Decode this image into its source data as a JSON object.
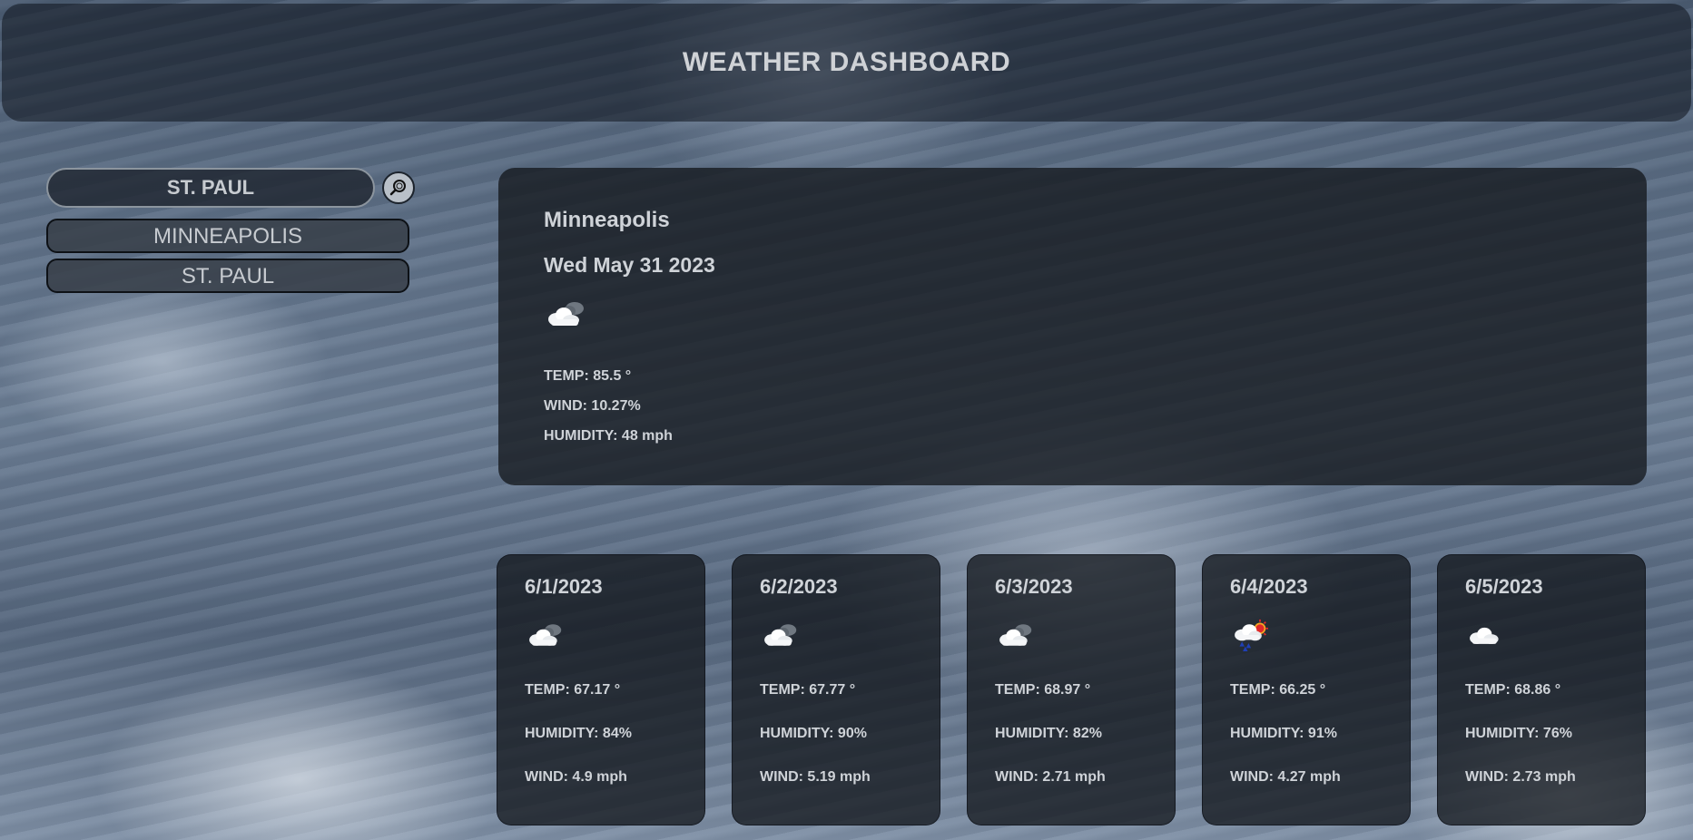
{
  "header": {
    "title": "WEATHER DASHBOARD"
  },
  "search": {
    "value": "ST. PAUL",
    "history": [
      "MINNEAPOLIS",
      "ST. PAUL"
    ]
  },
  "current": {
    "city": "Minneapolis",
    "date": "Wed May 31 2023",
    "icon": "broken-clouds-icon",
    "temp": "TEMP: 85.5 °",
    "wind": "WIND: 10.27%",
    "humidity": "HUMIDITY: 48 mph"
  },
  "forecast": [
    {
      "date": "6/1/2023",
      "icon": "broken-clouds-icon",
      "temp": "TEMP: 67.17 °",
      "humidity": "HUMIDITY: 84%",
      "wind": "WIND: 4.9 mph"
    },
    {
      "date": "6/2/2023",
      "icon": "broken-clouds-icon",
      "temp": "TEMP: 67.77 °",
      "humidity": "HUMIDITY: 90%",
      "wind": "WIND: 5.19 mph"
    },
    {
      "date": "6/3/2023",
      "icon": "broken-clouds-icon",
      "temp": "TEMP: 68.97 °",
      "humidity": "HUMIDITY: 82%",
      "wind": "WIND: 2.71 mph"
    },
    {
      "date": "6/4/2023",
      "icon": "rain-sun-icon",
      "temp": "TEMP: 66.25 °",
      "humidity": "HUMIDITY: 91%",
      "wind": "WIND: 4.27 mph"
    },
    {
      "date": "6/5/2023",
      "icon": "cloud-icon",
      "temp": "TEMP: 68.86 °",
      "humidity": "HUMIDITY: 76%",
      "wind": "WIND: 2.73 mph"
    }
  ]
}
